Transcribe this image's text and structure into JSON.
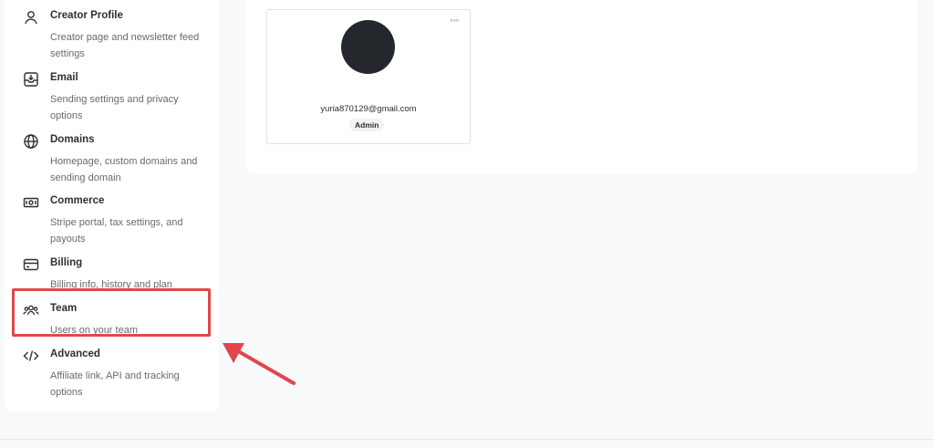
{
  "sidebar": {
    "items": [
      {
        "icon": "user-icon",
        "title": "Creator Profile",
        "description": "Creator page and newsletter feed settings"
      },
      {
        "icon": "inbox-icon",
        "title": "Email",
        "description": "Sending settings and privacy options"
      },
      {
        "icon": "globe-icon",
        "title": "Domains",
        "description": "Homepage, custom domains and sending domain"
      },
      {
        "icon": "cash-icon",
        "title": "Commerce",
        "description": "Stripe portal, tax settings, and payouts"
      },
      {
        "icon": "credit-card-icon",
        "title": "Billing",
        "description": "Billing info, history and plan"
      },
      {
        "icon": "team-icon",
        "title": "Team",
        "description": "Users on your team"
      },
      {
        "icon": "code-icon",
        "title": "Advanced",
        "description": "Affiliate link, API and tracking options"
      }
    ],
    "highlighted": "Team"
  },
  "team": {
    "members": [
      {
        "email": "yuria870129@gmail.com",
        "role": "Admin",
        "menu_icon": "more-options-icon"
      }
    ]
  },
  "colors": {
    "highlight": "#e0474c",
    "avatar": "#24282c",
    "text": "#2b3036",
    "muted": "#646b73"
  }
}
